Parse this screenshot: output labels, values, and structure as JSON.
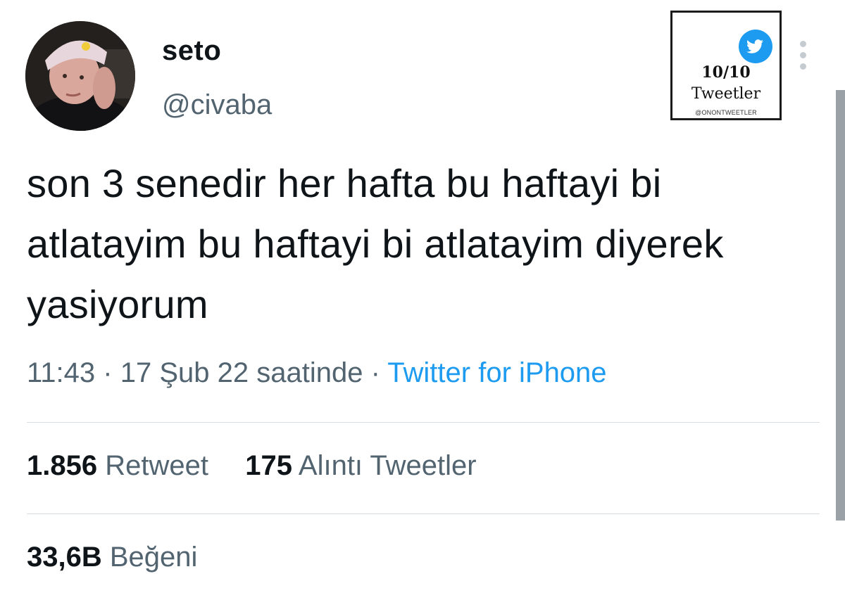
{
  "author": {
    "display_name": "seto",
    "handle": "@civaba"
  },
  "tweet": {
    "text": "son 3 senedir her hafta bu haftayi bi atlatayim bu haftayi bi atlatayim diyerek yasiyorum",
    "time": "11:43",
    "date": "17 Şub 22 saatinde",
    "separator": "·",
    "source": "Twitter for iPhone"
  },
  "stats": {
    "retweets": {
      "value": "1.856",
      "label": "Retweet"
    },
    "quotes": {
      "value": "175",
      "label": "Alıntı Tweetler"
    },
    "likes": {
      "value": "33,6B",
      "label": "Beğeni"
    }
  },
  "watermark": {
    "score": "10/10",
    "word": "Tweetler",
    "credit": "@ONONTWEETLER"
  },
  "colors": {
    "accent": "#1d9bf0",
    "text_primary": "#0f1419",
    "text_secondary": "#536471",
    "divider": "#d8dde1"
  },
  "icons": {
    "menu": "more-vertical-icon",
    "watermark": "twitter-bird-icon"
  }
}
